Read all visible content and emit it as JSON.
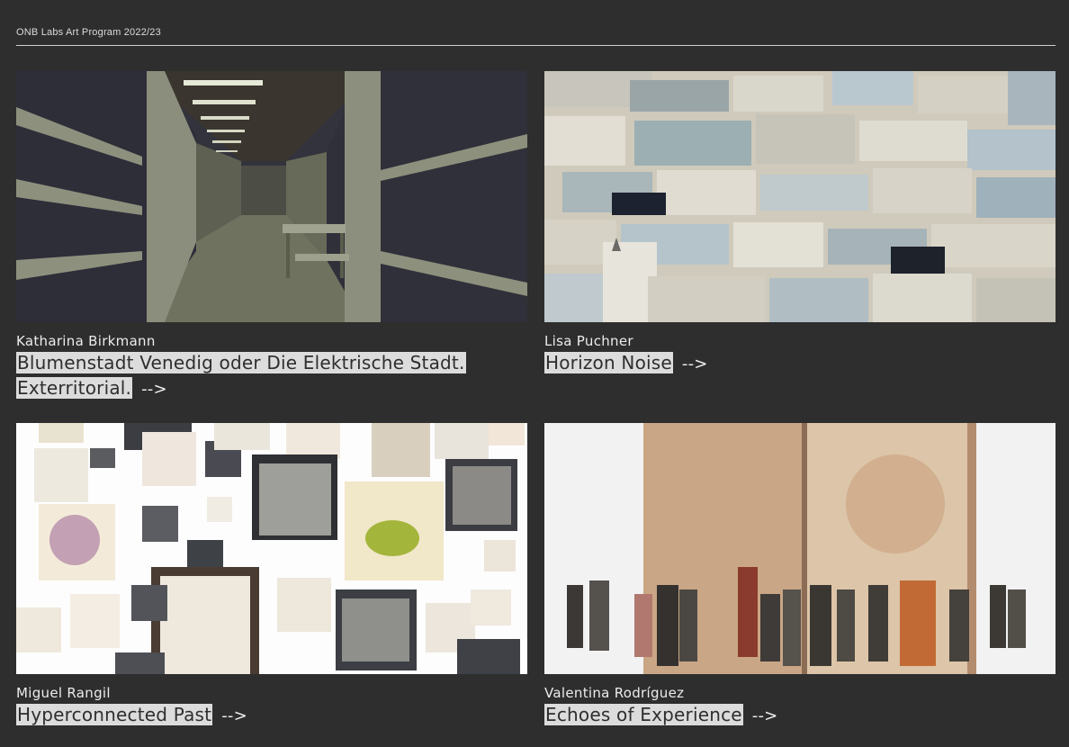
{
  "header": {
    "program_label": "ONB Labs Art Program 2022/23"
  },
  "projects": [
    {
      "artist": "Katharina Birkmann",
      "title": "Blumenstadt Venedig oder Die Elektrische Stadt. Exterritorial.",
      "arrow": "-->"
    },
    {
      "artist": "Lisa Puchner",
      "title": "Horizon Noise",
      "arrow": "-->"
    },
    {
      "artist": "Miguel Rangil",
      "title": "Hyperconnected Past",
      "arrow": "-->"
    },
    {
      "artist": "Valentina Rodríguez",
      "title": "Echoes of Experience",
      "arrow": "-->"
    }
  ],
  "colors": {
    "background": "#2e2e2e",
    "text": "#e6e6e6",
    "title_highlight": "#dcdcdc"
  }
}
